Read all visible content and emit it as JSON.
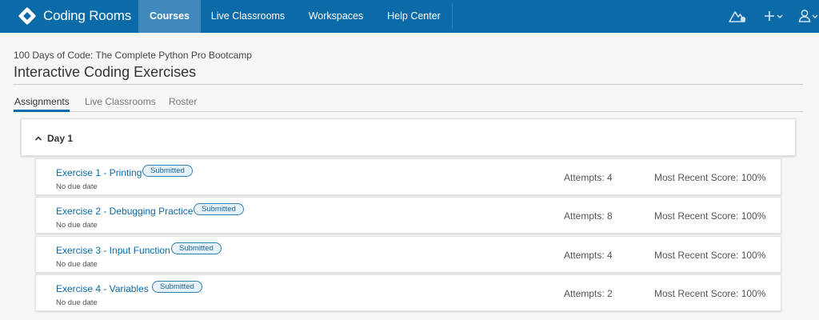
{
  "nav": {
    "brand": "Coding Rooms",
    "items": [
      "Courses",
      "Live Classrooms",
      "Workspaces",
      "Help Center"
    ],
    "active": "Courses",
    "icons": [
      "logo-diamond-icon",
      "mountain-icon",
      "plus-icon",
      "user-icon",
      "chevron-down-icon"
    ]
  },
  "course": {
    "name": "100 Days of Code: The Complete Python Pro Bootcamp",
    "title": "Interactive Coding Exercises"
  },
  "tabs": [
    "Assignments",
    "Live Classrooms",
    "Roster"
  ],
  "active_tab": "Assignments",
  "day": {
    "label": "Day 1",
    "expanded": true
  },
  "exercises": [
    {
      "title": "Exercise 1 - Printing",
      "status": "Submitted",
      "due": "No due date",
      "attempts": "Attempts: 4",
      "score": "Most Recent Score: 100%"
    },
    {
      "title": "Exercise 2 - Debugging Practice",
      "status": "Submitted",
      "due": "No due date",
      "attempts": "Attempts: 8",
      "score": "Most Recent Score: 100%"
    },
    {
      "title": "Exercise 3 - Input Function",
      "status": "Submitted",
      "due": "No due date",
      "attempts": "Attempts: 4",
      "score": "Most Recent Score: 100%"
    },
    {
      "title": "Exercise 4 - Variables",
      "status": "Submitted",
      "due": "No due date",
      "attempts": "Attempts: 2",
      "score": "Most Recent Score: 100%"
    }
  ],
  "colors": {
    "nav_bg": "#0b6aa8",
    "nav_active": "#3f89bd",
    "link": "#0b6aa8",
    "badge_border": "#2e7fb2",
    "badge_bg": "#e6f1f8",
    "page_bg": "#f7f7f7"
  }
}
